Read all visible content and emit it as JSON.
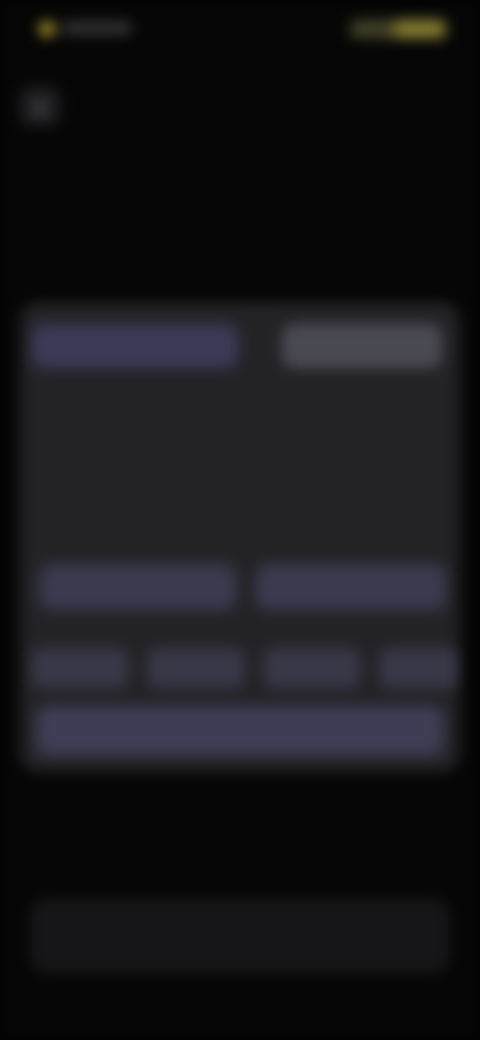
{
  "status_bar": {
    "time": "",
    "indicators": ""
  },
  "header": {
    "back_icon": "chevron-left-icon",
    "back_glyph": "‹",
    "title": ""
  },
  "hero": {
    "title": "",
    "subtitle": ""
  },
  "card": {
    "segments": [
      "",
      ""
    ],
    "description": "",
    "section_label": "",
    "options": [
      "",
      ""
    ],
    "chips": [
      "",
      "",
      "",
      ""
    ],
    "footer_button": ""
  },
  "bottom_button": {
    "label": ""
  },
  "colors": {
    "background": "#050505",
    "card": "#232326",
    "accent": "#3c3a57",
    "status_highlight": "#d9c23a"
  }
}
